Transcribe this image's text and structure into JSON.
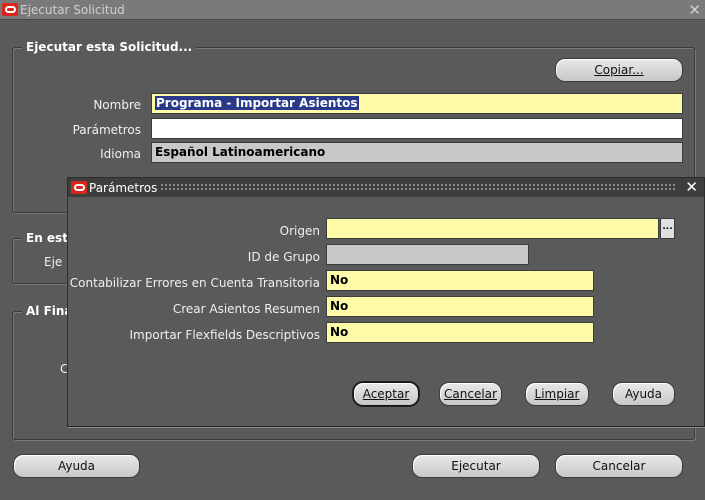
{
  "window": {
    "title": "Ejecutar Solicitud"
  },
  "request_group": {
    "title": "Ejecutar esta Solicitud...",
    "copy_button": "Copiar...",
    "name_label": "Nombre",
    "name_value": "Programa - Importar Asientos",
    "params_label": "Parámetros",
    "params_value": "",
    "language_label": "Idioma",
    "language_value": "Español Latinoamericano"
  },
  "schedule_group": {
    "title_partial": "En est",
    "label_partial": "Eje"
  },
  "completion_group": {
    "title_partial": "Al Fina",
    "label_partial": "C"
  },
  "footer": {
    "help_button": "Ayuda",
    "execute_button": "Ejecutar",
    "cancel_button": "Cancelar"
  },
  "dialog": {
    "title": "Parámetros",
    "fields": [
      {
        "label": "Origen",
        "value": ""
      },
      {
        "label": "ID de Grupo",
        "value": ""
      },
      {
        "label": "Contabilizar Errores en Cuenta Transitoria",
        "value": "No"
      },
      {
        "label": "Crear Asientos Resumen",
        "value": "No"
      },
      {
        "label": "Importar Flexfields Descriptivos",
        "value": "No"
      }
    ],
    "buttons": {
      "accept": "Aceptar",
      "cancel": "Cancelar",
      "clear": "Limpiar",
      "help": "Ayuda"
    },
    "lov_glyph": "..."
  },
  "colors": {
    "background": "#5a5a5a",
    "required_field": "#fffaa8",
    "disabled_field": "#c8c8c8",
    "brand": "#d9261c"
  }
}
